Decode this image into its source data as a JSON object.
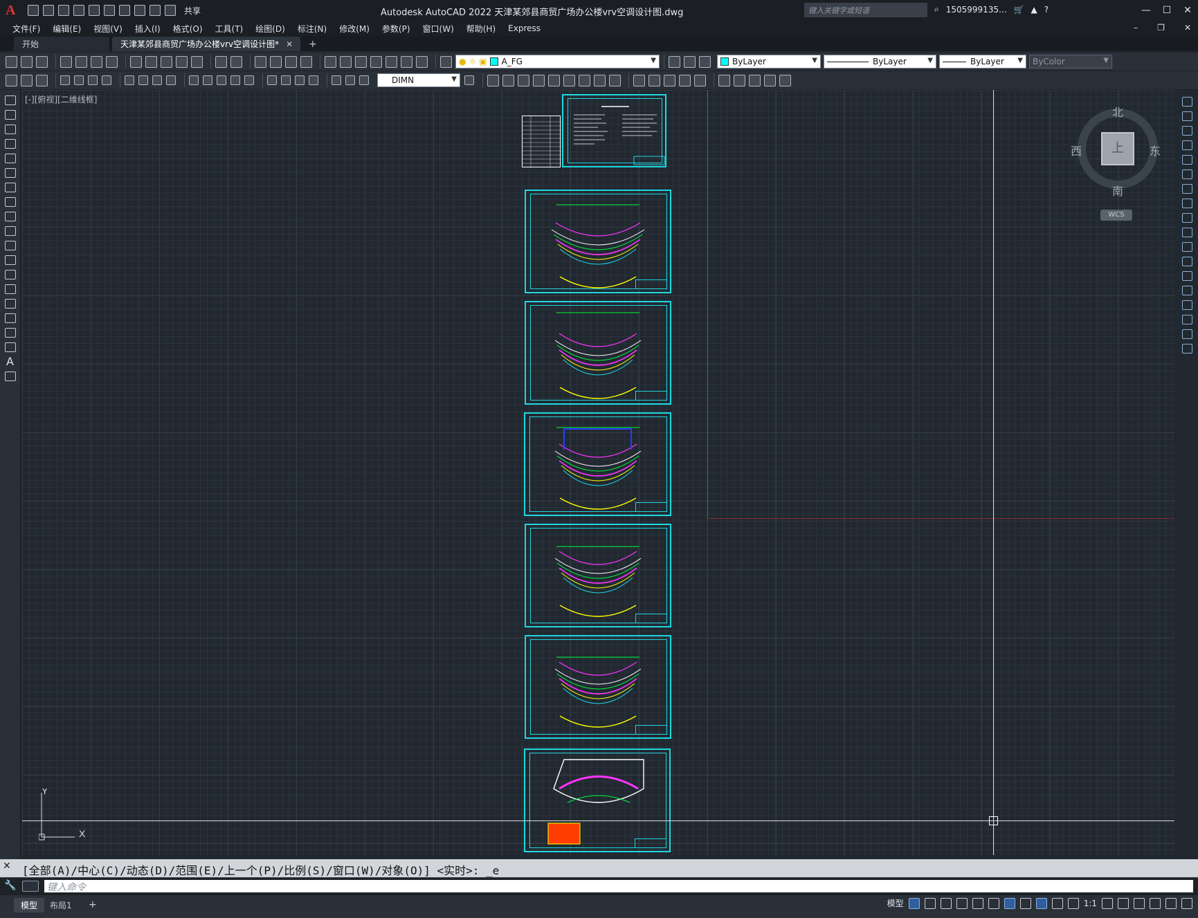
{
  "app": {
    "logo": "A",
    "title": "Autodesk AutoCAD 2022    天津某郊县商贸广场办公楼vrv空调设计图.dwg",
    "share_label": "共享",
    "search_placeholder": "键入关键字或短语",
    "user": "1505999135...",
    "window_controls": [
      "—",
      "☐",
      "✕"
    ]
  },
  "menu": {
    "items": [
      "文件(F)",
      "编辑(E)",
      "视图(V)",
      "插入(I)",
      "格式(O)",
      "工具(T)",
      "绘图(D)",
      "标注(N)",
      "修改(M)",
      "参数(P)",
      "窗口(W)",
      "帮助(H)",
      "Express"
    ]
  },
  "tabs": {
    "start": "开始",
    "active": "天津某郊县商贸广场办公楼vrv空调设计图*",
    "close": "✕",
    "add": "+"
  },
  "toolbar": {
    "layer": "A_FG",
    "layer_color": "#00ffff",
    "color": "ByLayer",
    "linetype": "ByLayer",
    "lineweight": "ByLayer",
    "plotstyle": "ByColor",
    "dimstyle": "DIMN"
  },
  "viewport": {
    "label": "[-][俯视][二维线框]",
    "compass": {
      "north": "北",
      "south": "南",
      "east": "东",
      "west": "西",
      "top": "上"
    },
    "wcs": "WCS",
    "ucs_x": "X",
    "ucs_y": "Y",
    "sheet_color": "#1ed8e0"
  },
  "command": {
    "history": "[全部(A)/中心(C)/动态(D)/范围(E)/上一个(P)/比例(S)/窗口(W)/对象(O)] <实时>: _e",
    "placeholder": "键入命令"
  },
  "status": {
    "tabs": [
      "模型",
      "布局1"
    ],
    "add": "+",
    "model_label": "模型",
    "scale": "1:1"
  }
}
